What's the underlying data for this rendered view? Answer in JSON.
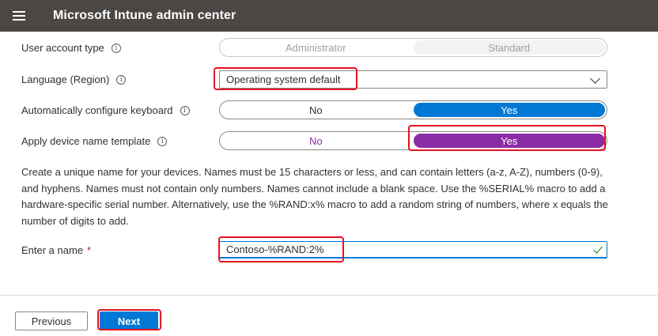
{
  "header": {
    "title": "Microsoft Intune admin center"
  },
  "form": {
    "user_account_type": {
      "label": "User account type",
      "options": [
        "Administrator",
        "Standard"
      ],
      "selected": "Standard"
    },
    "language": {
      "label": "Language (Region)",
      "value": "Operating system default"
    },
    "auto_keyboard": {
      "label": "Automatically configure keyboard",
      "options": [
        "No",
        "Yes"
      ],
      "selected": "Yes"
    },
    "device_name_template": {
      "label": "Apply device name template",
      "options": [
        "No",
        "Yes"
      ],
      "selected": "Yes"
    },
    "description": "Create a unique name for your devices. Names must be 15 characters or less, and can contain letters (a-z, A-Z), numbers (0-9), and hyphens. Names must not contain only numbers. Names cannot include a blank space. Use the %SERIAL% macro to add a hardware-specific serial number. Alternatively, use the %RAND:x% macro to add a random string of numbers, where x equals the number of digits to add.",
    "enter_name": {
      "label": "Enter a name",
      "required_marker": "*",
      "value": "Contoso-%RAND:2%"
    }
  },
  "footer": {
    "previous_label": "Previous",
    "next_label": "Next"
  },
  "colors": {
    "header_bg": "#4a4745",
    "accent": "#0078d4",
    "purple_selected": "#8a2da5",
    "highlight_red": "#e81123"
  },
  "icons": [
    "hamburger-icon",
    "info-icon",
    "chevron-down-icon",
    "check-icon"
  ]
}
